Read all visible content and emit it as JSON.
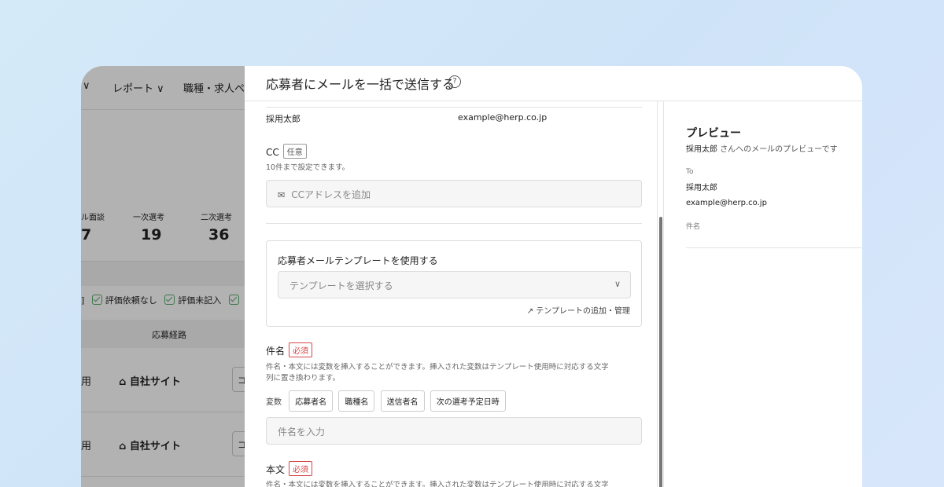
{
  "background_app": {
    "nav": [
      "∨",
      "レポート ∨",
      "職種・求人ペー"
    ],
    "stats": [
      {
        "label": "ール面談",
        "value": "7"
      },
      {
        "label": "一次選考",
        "value": "19"
      },
      {
        "label": "二次選考",
        "value": "36"
      }
    ],
    "filters": [
      "評価依頼なし",
      "評価未記入"
    ],
    "filter_prefix": "]",
    "column_header": "応募経路",
    "rows": [
      {
        "left": "用",
        "source": "自社サイト",
        "box": "コ"
      },
      {
        "left": "用",
        "source": "自社サイト",
        "box": "コ"
      }
    ]
  },
  "modal": {
    "title": "応募者にメールを一括で送信する",
    "help_icon": "?",
    "recipient": {
      "name": "採用太郎",
      "email": "example@herp.co.jp"
    },
    "cc": {
      "label": "CC",
      "tag": "任意",
      "hint": "10件まで設定できます。",
      "placeholder": "CCアドレスを追加"
    },
    "template": {
      "label": "応募者メールテンプレートを使用する",
      "placeholder": "テンプレートを選択する",
      "manage_link": "テンプレートの追加・管理"
    },
    "subject": {
      "label": "件名",
      "tag": "必須",
      "hint_line1": "件名・本文には変数を挿入することができます。挿入された変数はテンプレート使用時に対応する文字",
      "hint_line2": "列に置き換わります。",
      "vars_label": "変数",
      "vars": [
        "応募者名",
        "職種名",
        "送信者名",
        "次の選考予定日時"
      ],
      "placeholder": "件名を入力"
    },
    "body": {
      "label": "本文",
      "tag": "必須",
      "hint_line1": "件名・本文には変数を挿入することができます。挿入された変数はテンプレート使用時に対応する文字"
    },
    "preview": {
      "title": "プレビュー",
      "subtitle_name": "採用太郎",
      "subtitle_rest": "さんへのメールのプレビューです",
      "to_label": "To",
      "to_name": "採用太郎",
      "to_email": "example@herp.co.jp",
      "subject_label": "件名"
    }
  }
}
